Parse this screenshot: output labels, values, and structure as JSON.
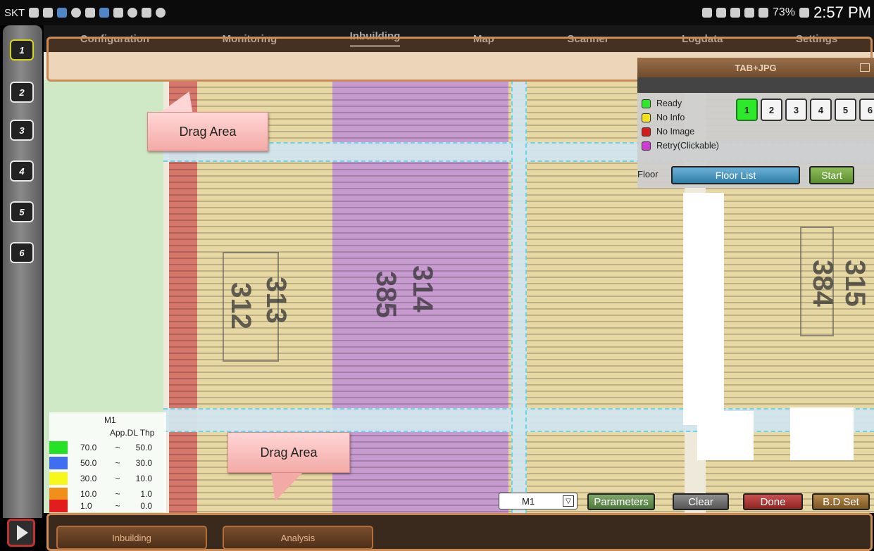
{
  "status_bar": {
    "carrier": "SKT",
    "battery": "73%",
    "time": "2:57 PM"
  },
  "rail": {
    "buttons": [
      "1",
      "2",
      "3",
      "4",
      "5",
      "6"
    ],
    "active": "1"
  },
  "tabs": [
    "Configuration",
    "Monitoring",
    "Inbuilding",
    "Map",
    "Scanner",
    "Logdata",
    "Settings"
  ],
  "active_tab": "Inbuilding",
  "panel": {
    "title": "TAB+JPG",
    "status_legend": [
      {
        "label": "Ready",
        "color": "#2ee82a"
      },
      {
        "label": "No Info",
        "color": "#f2e21c"
      },
      {
        "label": "No Image",
        "color": "#d51c1c"
      },
      {
        "label": "Retry(Clickable)",
        "color": "#d23ad6"
      }
    ],
    "floor_buttons": [
      "1",
      "2",
      "3",
      "4",
      "5",
      "6"
    ],
    "floor_label": "Floor",
    "floor_list_label": "Floor List",
    "start_label": "Start"
  },
  "callouts": {
    "top": "Drag Area",
    "bottom": "Drag Area"
  },
  "map": {
    "seat_numbers": [
      "312",
      "313",
      "385",
      "314",
      "384",
      "315"
    ]
  },
  "map_legend": {
    "title": "M1",
    "subtitle": "App.DL Thp",
    "rows": [
      {
        "color": "#25e225",
        "from": "70.0",
        "sep": "~",
        "to": "50.0"
      },
      {
        "color": "#3f6ff0",
        "from": "50.0",
        "sep": "~",
        "to": "30.0"
      },
      {
        "color": "#f7f71a",
        "from": "30.0",
        "sep": "~",
        "to": "10.0"
      },
      {
        "color": "#f08f1a",
        "from": "10.0",
        "sep": "~",
        "to": "1.0"
      },
      {
        "color": "#e21d1d",
        "from": "1.0",
        "sep": "~",
        "to": "0.0"
      }
    ]
  },
  "toolbar": {
    "metric_select": "M1",
    "parameters_label": "Parameters",
    "clear_label": "Clear",
    "done_label": "Done",
    "bdset_label": "B.D Set"
  },
  "bottom_bar": {
    "inbuilding_label": "Inbuilding",
    "analysis_label": "Analysis"
  }
}
